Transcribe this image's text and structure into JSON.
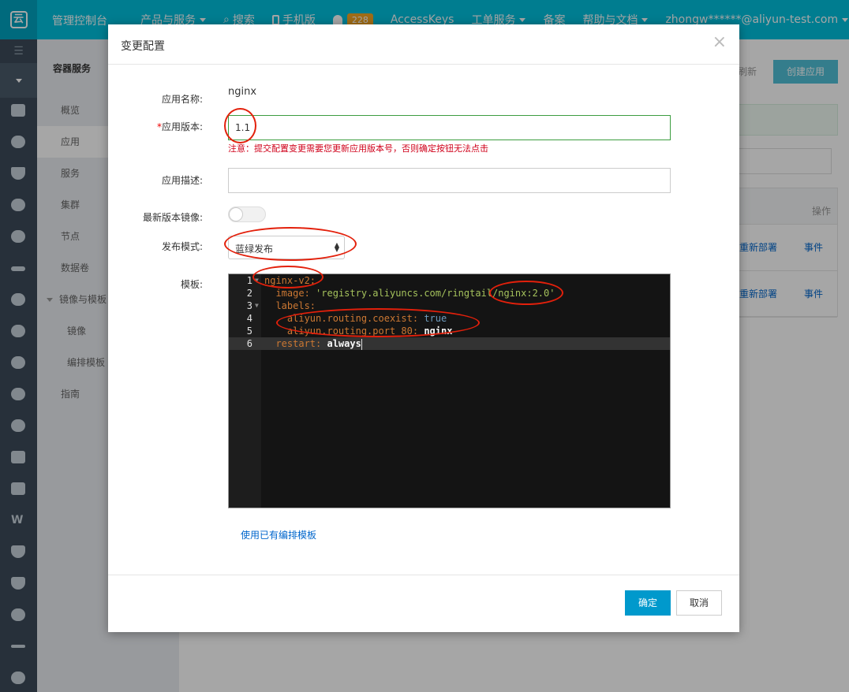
{
  "topbar": {
    "title": "管理控制台",
    "nav": [
      {
        "label": "产品与服务",
        "caret": true
      },
      {
        "label": "搜索",
        "icon": "search-icon"
      },
      {
        "label": "手机版",
        "icon": "mobile-icon"
      },
      {
        "label": "",
        "icon": "bell-icon",
        "badge": "228"
      },
      {
        "label": "AccessKeys"
      },
      {
        "label": "工单服务",
        "caret": true
      },
      {
        "label": "备案"
      },
      {
        "label": "帮助与文档",
        "caret": true
      },
      {
        "label": "zhongw******@aliyun-test.com",
        "caret": true
      }
    ]
  },
  "submenu": {
    "header": "容器服务",
    "items": [
      {
        "label": "概览"
      },
      {
        "label": "应用",
        "active": true
      },
      {
        "label": "服务"
      },
      {
        "label": "集群"
      },
      {
        "label": "节点"
      },
      {
        "label": "数据卷"
      },
      {
        "label": "镜像与模板",
        "group": true
      },
      {
        "label": "镜像",
        "sub": true
      },
      {
        "label": "编排模板",
        "sub": true
      },
      {
        "label": "指南"
      }
    ]
  },
  "background": {
    "refresh": "刷新",
    "create": "创建应用",
    "ops_header": "操作",
    "rows": [
      {
        "redeploy": "重新部署",
        "events": "事件"
      },
      {
        "redeploy": "重新部署",
        "events": "事件"
      }
    ]
  },
  "modal": {
    "title": "变更配置",
    "close": "×",
    "app_name_label": "应用名称:",
    "app_name": "nginx",
    "version_label": "应用版本:",
    "version_required": "*",
    "version_value": "1.1",
    "version_warning": "注意：提交配置变更需要您更新应用版本号，否则确定按钮无法点击",
    "desc_label": "应用描述:",
    "desc_value": "",
    "latest_image_label": "最新版本镜像:",
    "latest_image_on": false,
    "release_mode_label": "发布模式:",
    "release_mode": "蓝绿发布",
    "template_label": "模板:",
    "template_lines": [
      "nginx-v2:",
      "  image: 'registry.aliyuncs.com/ringtail/nginx:2.0'",
      "  labels:",
      "    aliyun.routing.coexist: true",
      "    aliyun.routing.port_80: nginx",
      "  restart: always"
    ],
    "code": {
      "l1_key": "nginx-v2:",
      "l2_key": "image:",
      "l2_val": "'registry.aliyuncs.com/ringtail/nginx:2.0'",
      "l3_key": "labels:",
      "l4_key": "aliyun.routing.coexist:",
      "l4_val": "true",
      "l5_key": "aliyun.routing.port_80:",
      "l5_val": "nginx",
      "l6_key": "restart:",
      "l6_val": "always"
    },
    "line_numbers": [
      "1",
      "2",
      "3",
      "4",
      "5",
      "6"
    ],
    "use_template_link": "使用已有编排模板",
    "ok": "确定",
    "cancel": "取消"
  },
  "colors": {
    "topbar": "#00c1de",
    "primary_button": "#0099cc",
    "annotation": "#e3200b",
    "warning_text": "#d0021b"
  }
}
